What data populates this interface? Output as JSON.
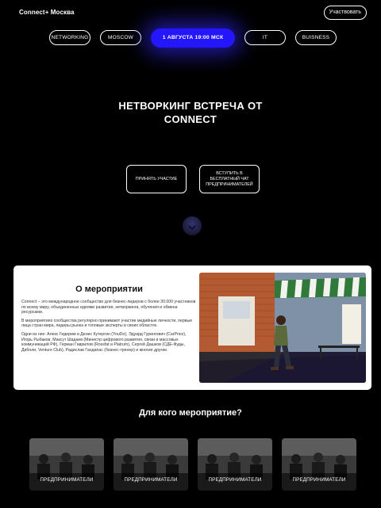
{
  "header": {
    "brand": "Connect+ Москва",
    "participate_label": "Участвовать"
  },
  "pills": {
    "networking": "NETWORKING",
    "city": "MOSCOW",
    "date": "1 АВГУСТА 19:00 МСК",
    "it": "IT",
    "business": "BUISNESS"
  },
  "hero": {
    "title_line1": "НЕТВОРКИНГ ВСТРЕЧА ОТ",
    "title_line2": "CONNECT",
    "cta_join": "ПРИНЯТЬ УЧАСТИЕ",
    "cta_chat": "ВСТУПИТЬ В БЕСПЛАТНЫЙ ЧАТ ПРЕДПРИНИМАТЕЛЕЙ"
  },
  "about": {
    "title": "О мероприятии",
    "paragraphs": [
      "Connect – это международное сообщество для бизнес-лидеров с более 30.000 участников по всему миру, объединенных идеями развития, нетворкинга, обучения и обмена ресурсами.",
      "В мероприятиях сообщества регулярно принимают участие медийные личности, первые лица стран мира, лидеры рынка и топовые эксперты в своих областях.",
      "Одни из них: Алекс Гидерим и Денис Кутергин (YouDo), Эдуард Гурингович (CarPrice), Игорь Рыбаков, Максут Шадаев (Министр цифрового развития, связи и массовых коммуникаций РФ), Герман Гаврилов (Rossfat и Platrum), Сергей Дашков (СДЕ-Фуды, Диболи, Venture Club), Радислав Гандапас (бизнес-тренер) и многие другие."
    ]
  },
  "audience": {
    "title": "Для кого мероприятие?",
    "cards": [
      {
        "label": "ПРЕДПРИНИМАТЕЛИ"
      },
      {
        "label": "ПРЕДПРИНИМАТЕЛИ"
      },
      {
        "label": "ПРЕДПРИНИМАТЕЛИ"
      },
      {
        "label": "ПРЕДПРИНИМАТЕЛИ"
      }
    ]
  },
  "colors": {
    "accent": "#2417ff",
    "background": "#000000",
    "card": "#ffffff"
  }
}
